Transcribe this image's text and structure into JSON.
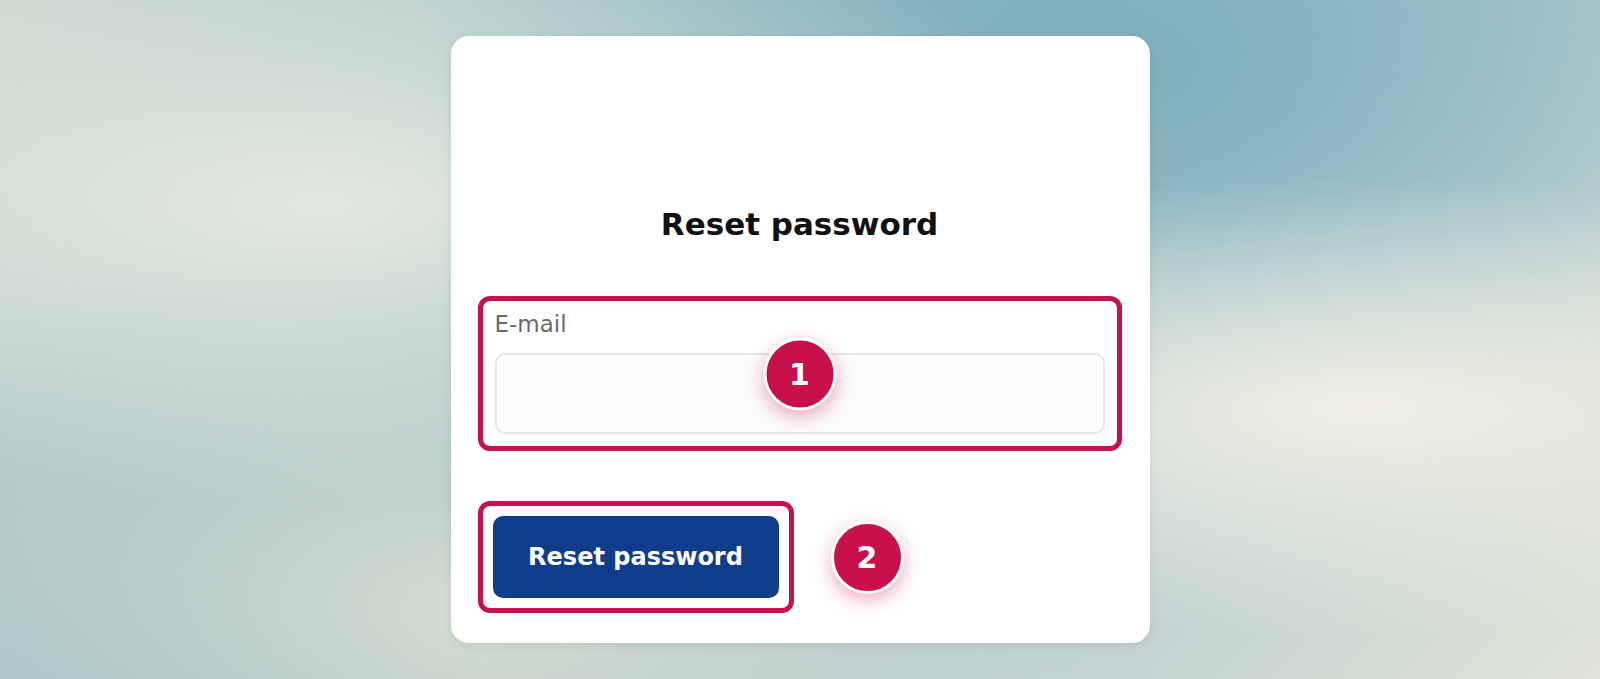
{
  "page": {
    "title": "Reset password"
  },
  "form": {
    "email": {
      "label": "E-mail",
      "value": ""
    },
    "submit": {
      "label": "Reset password"
    }
  },
  "annotations": [
    {
      "number": "1",
      "target": "email"
    },
    {
      "number": "2",
      "target": "submit"
    }
  ]
}
